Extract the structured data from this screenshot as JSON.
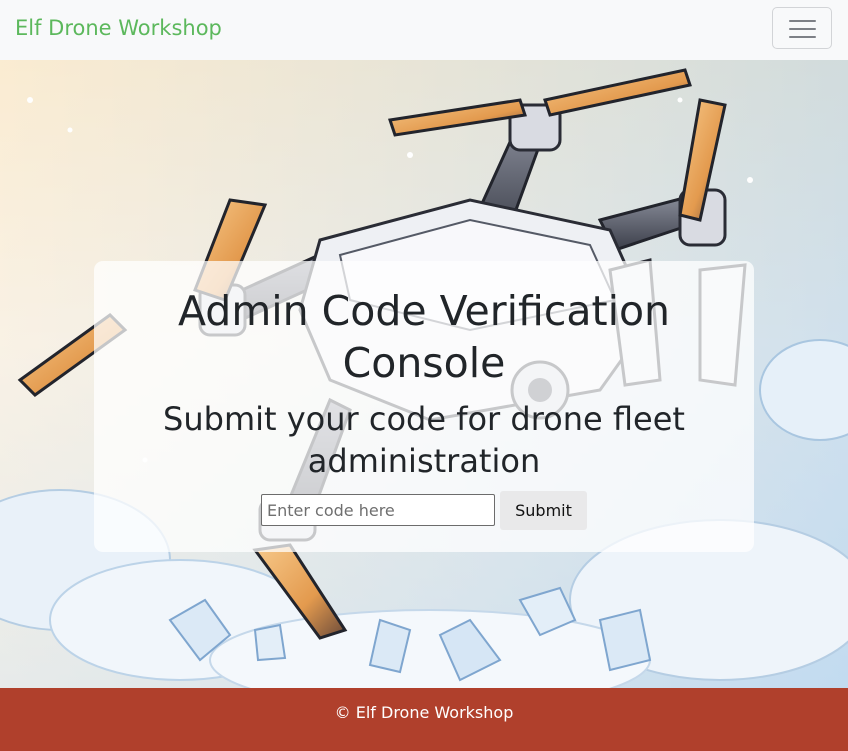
{
  "navbar": {
    "brand": "Elf Drone Workshop",
    "toggler_icon": "hamburger-menu-icon"
  },
  "hero": {
    "illustration": "drone-illustration",
    "colors": {
      "sky_top": "#f6e6c7",
      "sky_bottom": "#cfe2f3",
      "drone_body": "#eef0f4",
      "propeller": "#e7a25a"
    }
  },
  "card": {
    "title": "Admin Code Verification Console",
    "subtitle": "Submit your code for drone fleet administration",
    "input_placeholder": "Enter code here",
    "input_value": "",
    "submit_label": "Submit"
  },
  "footer": {
    "text": "© Elf Drone Workshop",
    "color": "#b0402c"
  }
}
